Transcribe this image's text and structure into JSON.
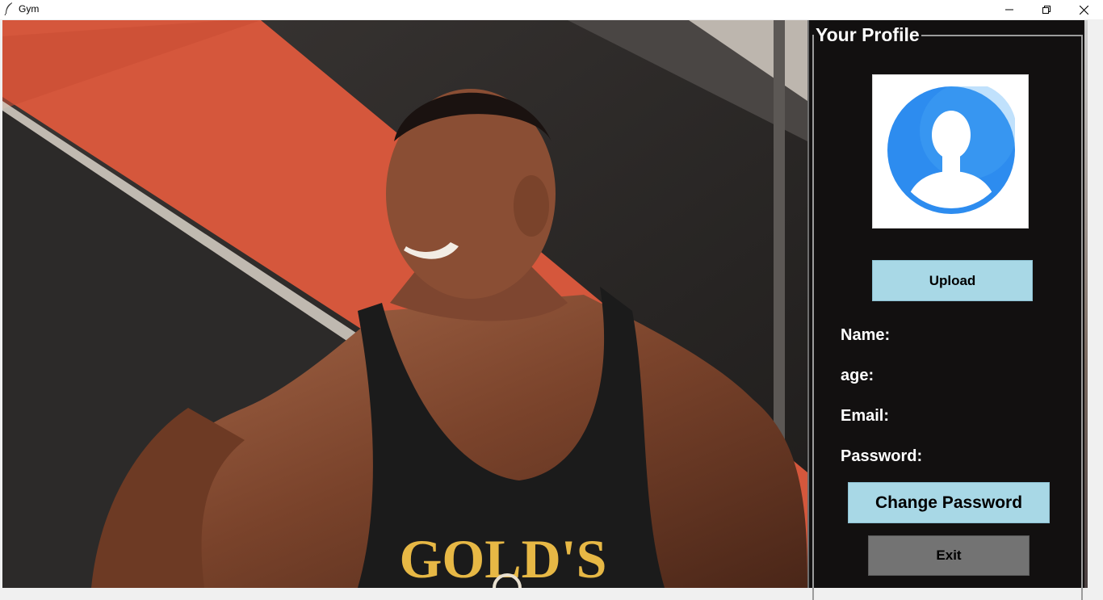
{
  "window": {
    "title": "Gym",
    "app_icon": "feather-icon",
    "controls": [
      "minimize-icon",
      "restore-icon",
      "close-icon"
    ]
  },
  "background_photo": {
    "brand_text": "GOLD'S"
  },
  "profile": {
    "section_title": "Your Profile",
    "avatar_icon": "user-avatar-icon",
    "upload_label": "Upload",
    "fields": {
      "name_label": "Name:",
      "age_label": "age:",
      "email_label": "Email:",
      "password_label": "Password:"
    },
    "change_password_label": "Change Password",
    "exit_label": "Exit"
  },
  "colors": {
    "panel_bg": "#121010",
    "button_accent": "#a8d8e6",
    "exit_button": "#737373",
    "avatar_blue": "#2d8cef"
  }
}
